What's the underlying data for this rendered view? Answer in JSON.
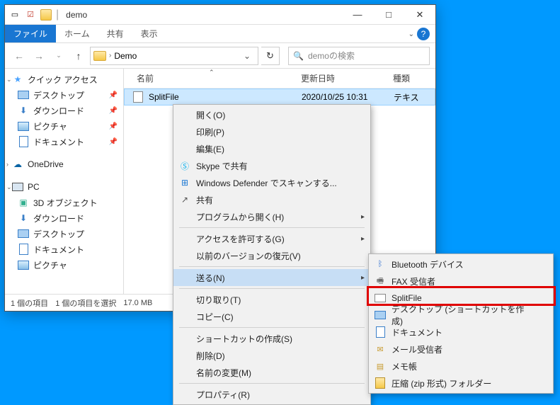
{
  "titlebar": {
    "title": "demo"
  },
  "winctrl": {
    "min": "—",
    "max": "□",
    "close": "✕"
  },
  "ribbon": {
    "file": "ファイル",
    "home": "ホーム",
    "share": "共有",
    "view": "表示",
    "help": "?"
  },
  "nav": {
    "back": "←",
    "fwd": "→",
    "up": "↑",
    "path_root": "Demo",
    "refresh": "↻",
    "search_placeholder": "demoの検索",
    "search_icon": "🔍"
  },
  "sidebar": {
    "quick": "クイック アクセス",
    "desktop": "デスクトップ",
    "downloads": "ダウンロード",
    "pictures": "ピクチャ",
    "documents": "ドキュメント",
    "onedrive": "OneDrive",
    "pc": "PC",
    "obj3d": "3D オブジェクト",
    "downloads2": "ダウンロード",
    "desktop2": "デスクトップ",
    "documents2": "ドキュメント",
    "pictures2": "ピクチャ"
  },
  "columns": {
    "name": "名前",
    "date": "更新日時",
    "type": "種類"
  },
  "file": {
    "name": "SplitFile",
    "date": "2020/10/25 10:31",
    "type": "テキス"
  },
  "status": {
    "count": "1 個の項目",
    "sel": "1 個の項目を選択",
    "size": "17.0 MB"
  },
  "ctx": {
    "open": "開く(O)",
    "print": "印刷(P)",
    "edit": "編集(E)",
    "skype": "Skype で共有",
    "defender": "Windows Defender でスキャンする...",
    "share": "共有",
    "openwith": "プログラムから開く(H)",
    "access": "アクセスを許可する(G)",
    "restore": "以前のバージョンの復元(V)",
    "send": "送る(N)",
    "cut": "切り取り(T)",
    "copy": "コピー(C)",
    "shortcut": "ショートカットの作成(S)",
    "delete": "削除(D)",
    "rename": "名前の変更(M)",
    "props": "プロパティ(R)"
  },
  "sub": {
    "bluetooth": "Bluetooth デバイス",
    "fax": "FAX 受信者",
    "splitfile": "SplitFile",
    "desktop": "デスクトップ (ショートカットを作成)",
    "documents": "ドキュメント",
    "mail": "メール受信者",
    "memo": "メモ帳",
    "zip": "圧縮 (zip 形式) フォルダー"
  }
}
